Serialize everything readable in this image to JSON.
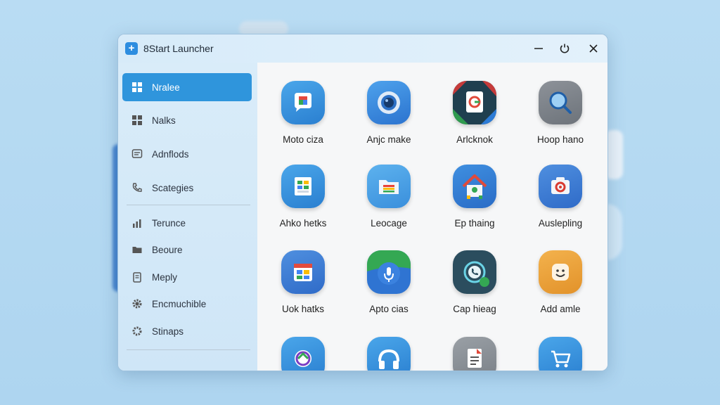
{
  "window": {
    "title": "8Start Launcher"
  },
  "colors": {
    "accent": "#2f95dc",
    "background": "#b9dcf3"
  },
  "sidebar": {
    "items": [
      {
        "label": "Nralee",
        "icon": "grid-icon",
        "active": true
      },
      {
        "label": "Nalks",
        "icon": "apps-icon"
      },
      {
        "label": "Adnflods",
        "icon": "message-icon"
      },
      {
        "label": "Scategies",
        "icon": "phone-icon"
      },
      {
        "label": "Terunce",
        "icon": "chart-icon"
      },
      {
        "label": "Beoure",
        "icon": "folder-icon"
      },
      {
        "label": "Meply",
        "icon": "clipboard-icon"
      },
      {
        "label": "Encmuchible",
        "icon": "gear-icon"
      },
      {
        "label": "Stinaps",
        "icon": "settings-icon"
      }
    ]
  },
  "apps": [
    {
      "label": "Moto ciza",
      "icon": "chat-bubble-icon"
    },
    {
      "label": "Anjc make",
      "icon": "camera-lens-icon"
    },
    {
      "label": "Arlcknok",
      "icon": "store-bag-icon"
    },
    {
      "label": "Hoop hano",
      "icon": "magnifier-icon"
    },
    {
      "label": "Ahko hetks",
      "icon": "spreadsheet-icon"
    },
    {
      "label": "Leocage",
      "icon": "folder-icon"
    },
    {
      "label": "Ep thaing",
      "icon": "home-icon"
    },
    {
      "label": "Auslepling",
      "icon": "camera-icon"
    },
    {
      "label": "Uok hatks",
      "icon": "calendar-icon"
    },
    {
      "label": "Apto cias",
      "icon": "microphone-icon"
    },
    {
      "label": "Cap hieag",
      "icon": "phone-circle-icon"
    },
    {
      "label": "Add amle",
      "icon": "smiley-icon"
    },
    {
      "label": "",
      "icon": "ring-icon"
    },
    {
      "label": "",
      "icon": "headphones-icon"
    },
    {
      "label": "",
      "icon": "document-icon"
    },
    {
      "label": "",
      "icon": "cart-icon"
    }
  ]
}
